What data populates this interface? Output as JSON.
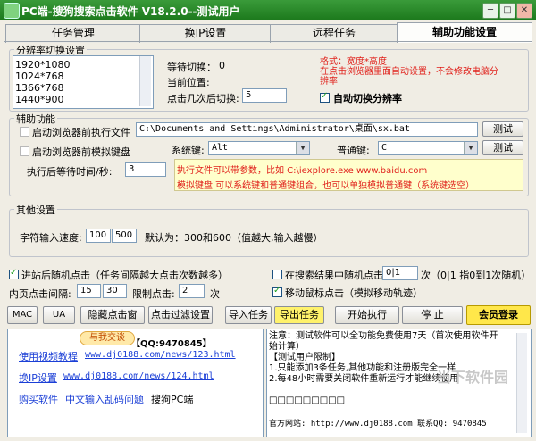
{
  "window": {
    "title": "PC端-搜狗搜索点击软件 V18.2.0--测试用户",
    "min": "─",
    "max": "□",
    "close": "✕"
  },
  "tabs": [
    "任务管理",
    "换IP设置",
    "远程任务",
    "辅助功能设置"
  ],
  "resolution": {
    "group_title": "分辨率切换设置",
    "list": [
      "1920*1080",
      "1024*768",
      "1366*768",
      "1440*900"
    ],
    "wait_label": "等待切换：",
    "wait_value": "0",
    "current_label": "当前位置:",
    "clicks_label": "点击几次后切换:",
    "clicks_value": "5",
    "format_note": "格式：宽度*高度\n在点击浏览器里面自动设置，不会修改电脑分辨率",
    "auto_switch_label": "自动切换分辨率"
  },
  "assist": {
    "group_title": "辅助功能",
    "exec_label": "启动浏览器前执行文件",
    "exec_path": "C:\\Documents and Settings\\Administrator\\桌面\\sx.bat",
    "test_label": "测试",
    "kbd_label": "启动浏览器前模拟键盘",
    "syskey_label": "系统键:",
    "syskey_value": "Alt",
    "normalkey_label": "普通键:",
    "normalkey_value": "C",
    "wait_after_label": "执行后等待时间/秒:",
    "wait_after_value": "3",
    "note_line1": "执行文件可以带参数，比如 C:\\iexplore.exe www.baidu.com",
    "note_line2": "模拟键盘 可以系统键和普通键组合，也可以单独模拟普通键（系统键选空）"
  },
  "other": {
    "group_title": "其他设置",
    "speed_label": "字符输入速度:",
    "speed_min": "100",
    "speed_max": "500",
    "default_note": "默认为：300和600（值越大,输入越慢）"
  },
  "options": {
    "random_after_label": "进站后随机点击（任务间隔越大点击次数越多）",
    "random_in_results_label": "在搜索结果中随机点击",
    "random_value": "0|1",
    "random_note": "次（0|1 指0到1次随机）",
    "interval_label": "内页点击间隔:",
    "interval_min": "15",
    "interval_max": "30",
    "limit_label": "限制点击:",
    "limit_value": "2",
    "limit_unit": "次",
    "move_mouse_label": "移动鼠标点击（模拟移动轨迹）"
  },
  "toolbar": [
    "MAC",
    "UA",
    "隐藏点击窗",
    "点击过滤设置",
    "导入任务",
    "导出任务",
    "开始执行",
    "停 止",
    "会员登录"
  ],
  "info": {
    "cloud_text": "与我交谈",
    "qq": "【QQ:9470845】",
    "links": [
      {
        "label": "使用视频教程",
        "url": "www.dj0188.com/news/123.html"
      },
      {
        "label": "换IP设置",
        "url": "www.dj0188.com/news/124.html"
      }
    ],
    "bottom_link1": "购买软件",
    "bottom_link2": "中文输入乱码问题",
    "bottom_text": "搜狗PC端"
  },
  "notice": {
    "lines": [
      "注意：测试软件可以全功能免费使用7天（首次使用软件开",
      "始计算）",
      "【测试用户限制】",
      "1.只能添加3条任务,其他功能和注册版完全一样",
      "2.每48小时需要关闭软件重新运行才能继续使用",
      "",
      "□□□□□□□□□",
      "",
      "官方网站: http://www.dj0188.com  联系QQ: 9470845"
    ]
  },
  "watermark": "当下软件园",
  "colors": {
    "title_green": "#2a8b2a",
    "note_bg": "#ffffcc",
    "note_red": "#e0221c",
    "login_bg": "#ffe74a",
    "export_bg": "#fff26b"
  }
}
